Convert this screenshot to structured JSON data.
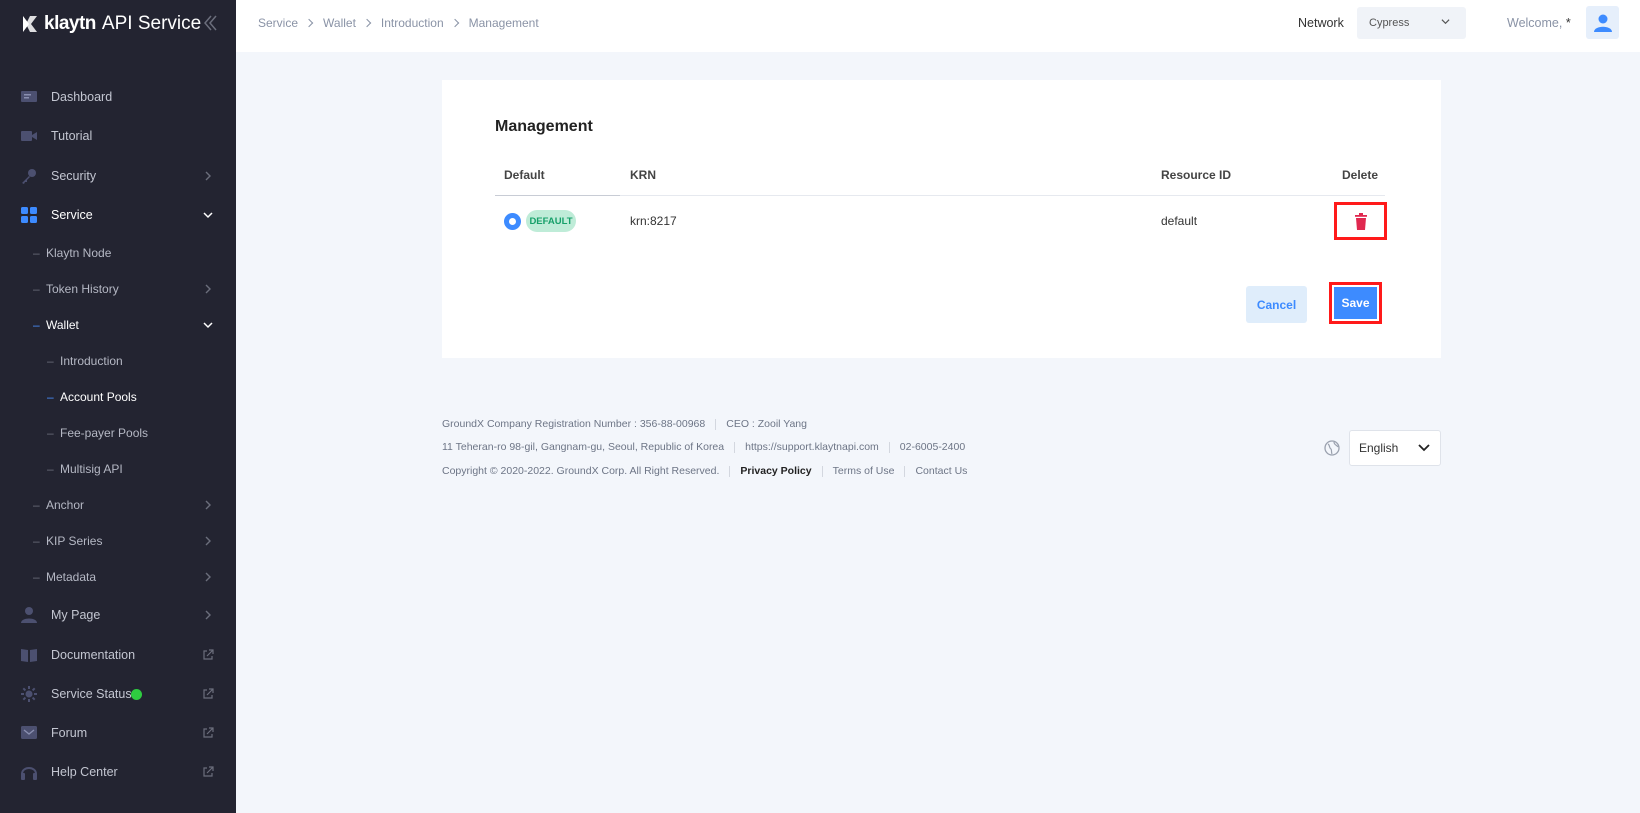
{
  "brand": {
    "name_bold": "klaytn",
    "name_rest": "API Service"
  },
  "sidebar": {
    "items": [
      {
        "label": "Dashboard"
      },
      {
        "label": "Tutorial"
      },
      {
        "label": "Security"
      },
      {
        "label": "Service"
      },
      {
        "label": "My Page"
      },
      {
        "label": "Documentation"
      },
      {
        "label": "Service Status"
      },
      {
        "label": "Forum"
      },
      {
        "label": "Help Center"
      }
    ],
    "service_sub": [
      {
        "label": "Klaytn Node"
      },
      {
        "label": "Token History"
      },
      {
        "label": "Wallet"
      },
      {
        "label": "Anchor"
      },
      {
        "label": "KIP Series"
      },
      {
        "label": "Metadata"
      }
    ],
    "wallet_sub": [
      {
        "label": "Introduction"
      },
      {
        "label": "Account Pools"
      },
      {
        "label": "Fee-payer Pools"
      },
      {
        "label": "Multisig API"
      }
    ],
    "service_status_color": "#2ecc40"
  },
  "header": {
    "breadcrumb": [
      "Service",
      "Wallet",
      "Introduction",
      "Management"
    ],
    "network_label": "Network",
    "network_value": "Cypress",
    "welcome": "Welcome,",
    "welcome_user": "*"
  },
  "main": {
    "title": "Management",
    "columns": [
      "Default",
      "KRN",
      "Resource ID",
      "Delete"
    ],
    "rows": [
      {
        "badge": "DEFAULT",
        "krn": "krn:8217",
        "resource_id": "default"
      }
    ],
    "cancel_label": "Cancel",
    "save_label": "Save"
  },
  "footer": {
    "registration": "GroundX Company Registration Number : 356-88-00968",
    "ceo": "CEO : Zooil Yang",
    "address": "11 Teheran-ro 98-gil, Gangnam-gu, Seoul, Republic of Korea",
    "support_url": "https://support.klaytnapi.com",
    "phone": "02-6005-2400",
    "copyright": "Copyright © 2020-2022. GroundX Corp. All Right Reserved.",
    "privacy": "Privacy Policy",
    "terms": "Terms of Use",
    "contact": "Contact Us",
    "language": "English"
  },
  "colors": {
    "accent": "#3d8bff",
    "sidebar_bg": "#232431",
    "highlight": "#ff1a1a",
    "badge_bg": "#bfecd8",
    "badge_text": "#17a06a"
  }
}
